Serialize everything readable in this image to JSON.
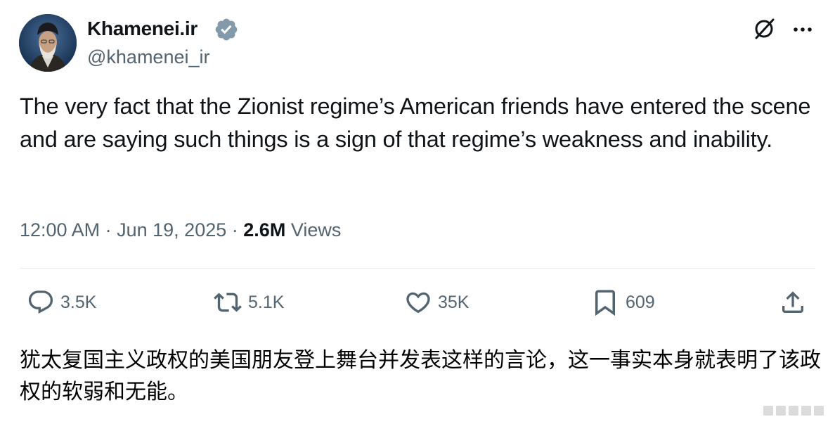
{
  "post": {
    "author": {
      "display_name": "Khamenei.ir",
      "handle": "@khamenei_ir",
      "verified": true,
      "verified_color": "#829aab"
    },
    "text": "The very fact that the Zionist regime’s American friends have entered the scene and are saying such things is a sign of that regime’s weakness and inability.",
    "meta": {
      "time": "12:00 AM",
      "separator": "·",
      "date": "Jun 19, 2025",
      "views_count": "2.6M",
      "views_label": "Views"
    },
    "actions": {
      "replies": "3.5K",
      "reposts": "5.1K",
      "likes": "35K",
      "bookmarks": "609"
    },
    "header_icons": [
      "grok-icon",
      "more-options-icon"
    ]
  },
  "translation": {
    "text": "犹太复国主义政权的美国朋友登上舞台并发表这样的言论，这一事实本身就表明了该政权的软弱和无能。"
  },
  "colors": {
    "text_primary": "#0f1419",
    "text_secondary": "#536471",
    "divider": "#e6ecf0"
  }
}
